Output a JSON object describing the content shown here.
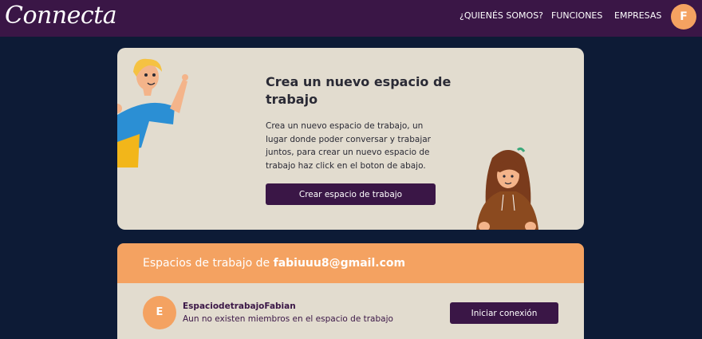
{
  "nav": {
    "logo": "Connecta",
    "links": [
      "¿QUIENÉS SOMOS?",
      "FUNCIONES",
      "EMPRESAS"
    ],
    "avatar_initial": "F"
  },
  "hero": {
    "title": "Crea un nuevo espacio de trabajo",
    "description": "Crea un nuevo espacio de trabajo, un lugar donde poder conversar y trabajar juntos, para crear un nuevo espacio de trabajo haz click en el boton de abajo.",
    "button_label": "Crear espacio de trabajo"
  },
  "workspaces": {
    "header_prefix": "Espacios de trabajo de ",
    "header_email": "fabiuuu8@gmail.com",
    "items": [
      {
        "initial": "E",
        "name": "EspaciodetrabajoFabian",
        "subtitle": "Aun no existen miembros en el espacio de trabajo",
        "button_label": "Iniciar conexión"
      }
    ]
  },
  "colors": {
    "navbar": "#3a1646",
    "background": "#0d1b36",
    "card": "#e2dccf",
    "accent": "#f4a261",
    "button": "#3a1646"
  }
}
